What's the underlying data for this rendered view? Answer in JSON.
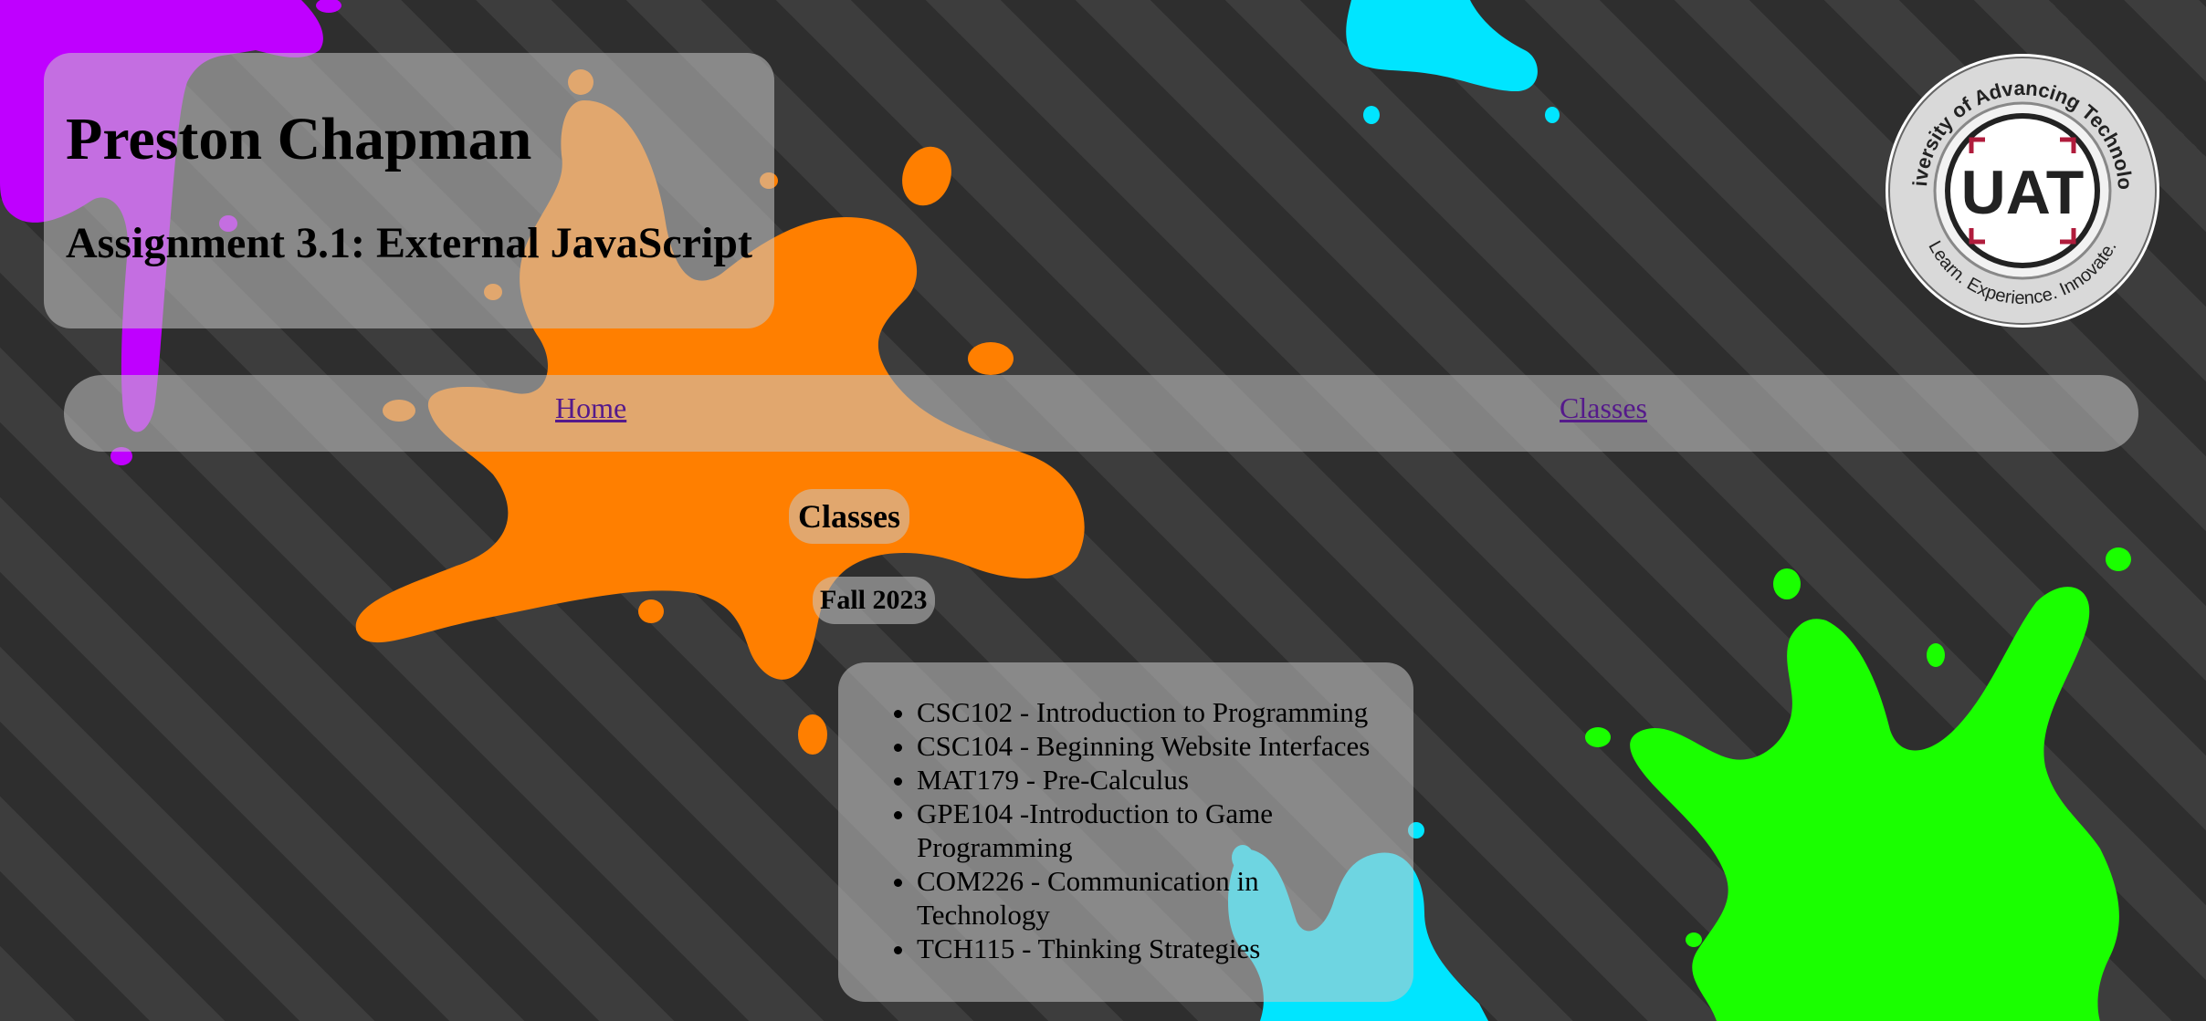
{
  "header": {
    "name": "Preston Chapman",
    "assignment": "Assignment 3.1: External JavaScript"
  },
  "logo": {
    "ring_text_top": "University of Advancing Technology",
    "ring_text_bottom": "Learn. Experience. Innovate.",
    "center_text": "UAT"
  },
  "nav": {
    "home_label": "Home",
    "classes_label": "Classes"
  },
  "main": {
    "title": "Classes",
    "term": "Fall 2023",
    "courses": [
      "CSC102 - Introduction to Programming",
      "CSC104 - Beginning Website Interfaces",
      "MAT179 - Pre-Calculus",
      "GPE104 -Introduction to Game Programming",
      "COM226 - Communication in Technology",
      "TCH115 - Thinking Strategies"
    ]
  },
  "colors": {
    "splat_purple": "#bf00ff",
    "splat_orange": "#ff7f00",
    "splat_cyan": "#00e5ff",
    "splat_green": "#1aff00",
    "panel": "#c8c8c8",
    "link": "#551a8b"
  }
}
